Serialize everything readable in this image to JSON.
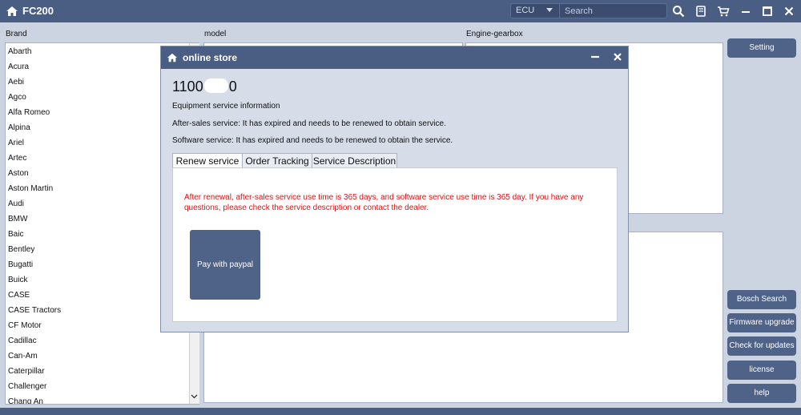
{
  "app": {
    "title": "FC200"
  },
  "toolbar": {
    "ecu_label": "ECU",
    "search_placeholder": "Search"
  },
  "columns": {
    "brand": "Brand",
    "model": "model",
    "engine": "Engine-gearbox"
  },
  "brands": [
    "Abarth",
    "Acura",
    "Aebi",
    "Agco",
    "Alfa Romeo",
    "Alpina",
    "Ariel",
    "Artec",
    "Aston",
    "Aston Martin",
    "Audi",
    "BMW",
    "Baic",
    "Bentley",
    "Bugatti",
    "Buick",
    "CASE",
    "CASE Tractors",
    "CF Motor",
    "Cadillac",
    "Can-Am",
    "Caterpillar",
    "Challenger",
    "Chang An"
  ],
  "side_buttons": {
    "setting": "Setting",
    "bosch_search": "Bosch Search",
    "firmware_upgrade": "Firmware upgrade",
    "check_updates": "Check for updates",
    "license": "license",
    "help": "help"
  },
  "dialog": {
    "title": "online store",
    "serial_prefix": "1100",
    "serial_suffix": "0",
    "info_heading": "Equipment service information",
    "after_sales": "After-sales service: It has expired and needs to be renewed to obtain service.",
    "software_service": "Software service: It has expired and needs to be renewed to obtain the service.",
    "tabs": [
      "Renew service",
      "Order Tracking",
      "Service Description"
    ],
    "renew_message": "After renewal, after-sales service use time is 365 days, and software service use time is 365 day. If you have any questions, please check the service description or contact the dealer.",
    "paypal_button": "Pay with paypal"
  },
  "colors": {
    "header": "#4a5d82",
    "button": "#4f6288",
    "warning_text": "#dd1111"
  }
}
